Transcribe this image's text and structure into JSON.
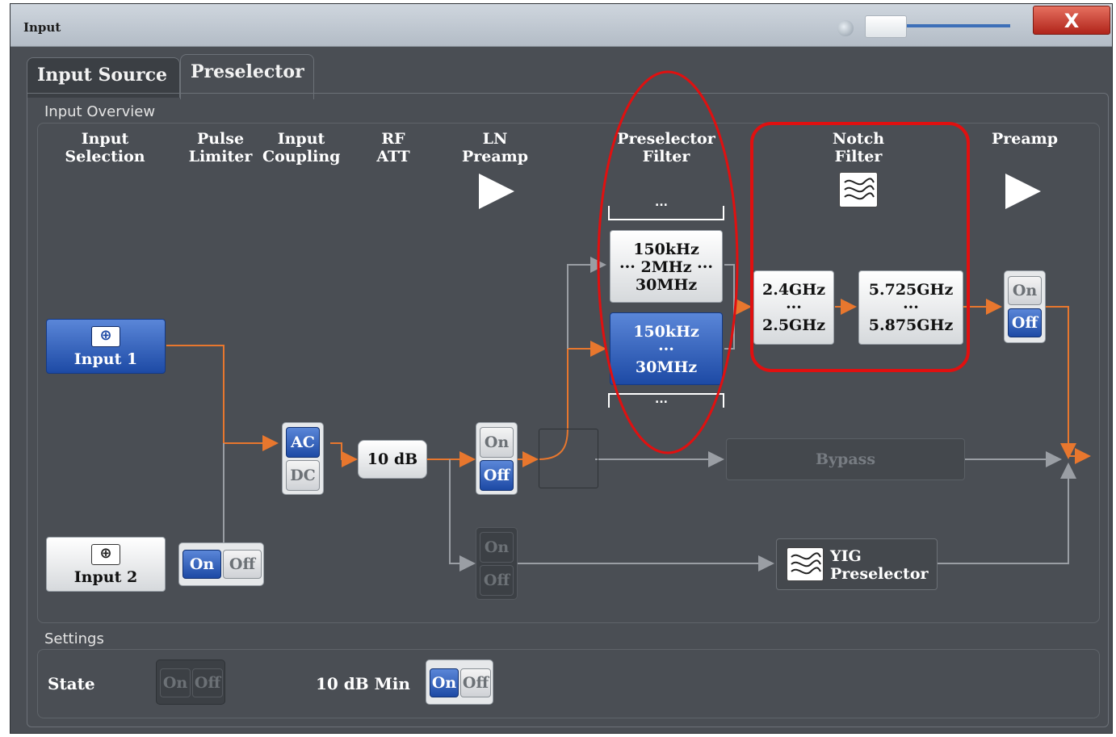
{
  "window": {
    "title": "Input",
    "close_label": "X"
  },
  "tabs": [
    {
      "label": "Input Source",
      "active": false
    },
    {
      "label": "Preselector",
      "active": true
    }
  ],
  "overview": {
    "section_label": "Input Overview",
    "headers": {
      "input_selection": [
        "Input",
        "Selection"
      ],
      "pulse_limiter": [
        "Pulse",
        "Limiter"
      ],
      "input_coupling": [
        "Input",
        "Coupling"
      ],
      "rf_att": [
        "RF",
        "ATT"
      ],
      "ln_preamp": [
        "LN",
        "Preamp"
      ],
      "preselector_filter": [
        "Preselector",
        "Filter"
      ],
      "notch_filter": [
        "Notch",
        "Filter"
      ],
      "preamp": [
        "Preamp"
      ]
    },
    "input1_label": "Input 1",
    "input2_label": "Input 2",
    "pulse_limiter_toggle": {
      "on": "On",
      "off": "Off",
      "state": "On"
    },
    "coupling": {
      "ac": "AC",
      "dc": "DC",
      "selected": "AC"
    },
    "rf_att_value": "10 dB",
    "ln_preamp_toggle": {
      "on": "On",
      "off": "Off",
      "state": "Off"
    },
    "lower_ln_toggle": {
      "on": "On",
      "off": "Off"
    },
    "preselector_filters": {
      "top_ellipsis": "...",
      "filter1": {
        "line1": "150kHz",
        "line2": "··· 2MHz ···",
        "line3": "30MHz",
        "selected": false
      },
      "filter2": {
        "line1": "150kHz",
        "line2": "···",
        "line3": "30MHz",
        "selected": true
      },
      "bottom_ellipsis": "..."
    },
    "notch": {
      "band1": {
        "line1": "2.4GHz",
        "line2": "···",
        "line3": "2.5GHz"
      },
      "band2": {
        "line1": "5.725GHz",
        "line2": "···",
        "line3": "5.875GHz"
      }
    },
    "preamp_toggle": {
      "on": "On",
      "off": "Off",
      "state": "Off"
    },
    "bypass_label": "Bypass",
    "yig": {
      "line1": "YIG",
      "line2": "Preselector"
    }
  },
  "settings": {
    "section_label": "Settings",
    "state_label": "State",
    "state_toggle": {
      "on": "On",
      "off": "Off"
    },
    "min_label": "10 dB Min",
    "min_toggle": {
      "on": "On",
      "off": "Off",
      "state": "On"
    }
  },
  "colors": {
    "signal_path": "#e8772e",
    "inactive_path": "#9a9ea4",
    "highlight": "#e01010",
    "selected": "#2b5bbf"
  },
  "icons": [
    "input-connector-icon",
    "notch-filter-icon",
    "yig-filter-icon",
    "amplifier-triangle-icon"
  ]
}
